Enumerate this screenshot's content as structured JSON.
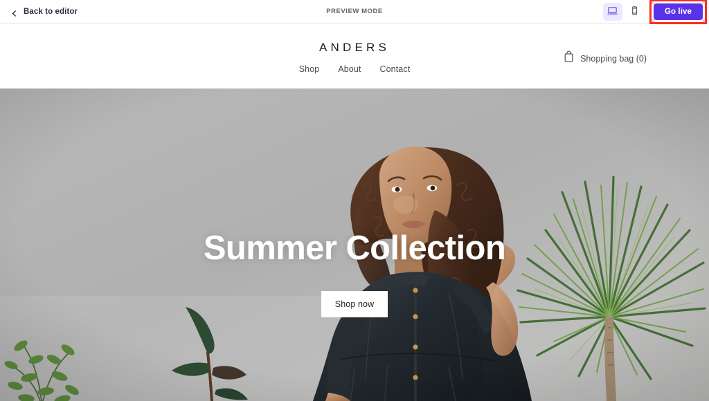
{
  "editor_toolbar": {
    "back_label": "Back to editor",
    "back_icon": "chevron-left-icon",
    "preview_mode_label": "PREVIEW MODE",
    "desktop_icon": "desktop-monitor-icon",
    "mobile_icon": "mobile-phone-icon",
    "active_device": "desktop",
    "go_live_label": "Go live",
    "go_live_color": "#5b32e8",
    "selection_box_color": "#ff2d16",
    "text_color": "#2b2b42",
    "preview_text_color": "#61616e"
  },
  "site": {
    "logo": "ANDERS",
    "nav": [
      {
        "label": "Shop"
      },
      {
        "label": "About"
      },
      {
        "label": "Contact"
      }
    ],
    "cart": {
      "icon": "shopping-bag-icon",
      "label": "Shopping bag (0)",
      "count": 0
    }
  },
  "hero": {
    "title": "Summer Collection",
    "cta_label": "Shop now",
    "title_color": "#ffffff",
    "cta_bg": "#ffffff",
    "cta_text_color": "#1f1f1f",
    "scene": {
      "description": "Fashion photo of a woman with long curly brown hair leaning on a rust-colored bentwood chair against a light gray wall, wearing a dark charcoal linen button dress, with a dracaena palm on the right and green foliage in the lower left.",
      "wall_color": "#b2b2b2",
      "dress_color": "#22282c",
      "chair_color": "#a5472e",
      "plant_color": "#4e7a3c",
      "skin_color": "#b98a6b",
      "hair_color": "#4a2c1e"
    }
  }
}
